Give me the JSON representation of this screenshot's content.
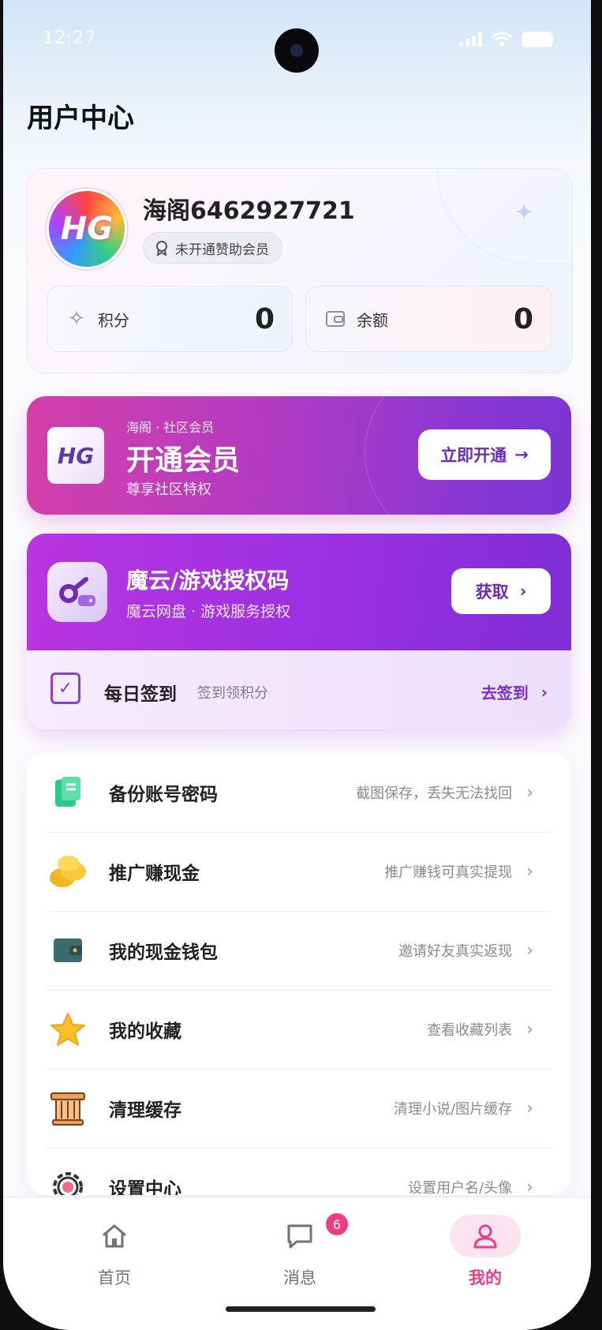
{
  "status_bar": {
    "time": "12:27"
  },
  "header": {
    "title": "用户中心"
  },
  "profile": {
    "avatar_text": "HG",
    "username": "海阁6462927721",
    "membership_status": "未开通赞助会员",
    "points": {
      "label": "积分",
      "value": "0"
    },
    "balance": {
      "label": "余额",
      "value": "0"
    }
  },
  "vip_banner": {
    "logo_text": "HG",
    "kicker": "海阁 · 社区会员",
    "title": "开通会员",
    "subtitle": "尊享社区特权",
    "button_label": "立即开通"
  },
  "game_code": {
    "title": "魔云/游戏授权码",
    "subtitle": "魔云网盘 · 游戏服务授权",
    "button_label": "获取"
  },
  "daily_signin": {
    "title": "每日签到",
    "subtitle": "签到领积分",
    "action_label": "去签到"
  },
  "menu": {
    "items": [
      {
        "label": "备份账号密码",
        "desc": "截图保存，丢失无法找回",
        "icon": "document-icon"
      },
      {
        "label": "推广赚现金",
        "desc": "推广赚钱可真实提现",
        "icon": "coins-icon"
      },
      {
        "label": "我的现金钱包",
        "desc": "邀请好友真实返现",
        "icon": "wallet-icon"
      },
      {
        "label": "我的收藏",
        "desc": "查看收藏列表",
        "icon": "star-icon"
      },
      {
        "label": "清理缓存",
        "desc": "清理小说/图片缓存",
        "icon": "pillar-icon"
      },
      {
        "label": "设置中心",
        "desc": "设置用户名/头像",
        "icon": "gear-icon"
      }
    ]
  },
  "tabbar": {
    "tabs": [
      {
        "label": "首页",
        "icon": "home-icon"
      },
      {
        "label": "消息",
        "icon": "message-icon",
        "badge": "6"
      },
      {
        "label": "我的",
        "icon": "user-icon",
        "active": true
      }
    ]
  },
  "colors": {
    "accent": "#ea3f88",
    "purple": "#8a37d3"
  }
}
